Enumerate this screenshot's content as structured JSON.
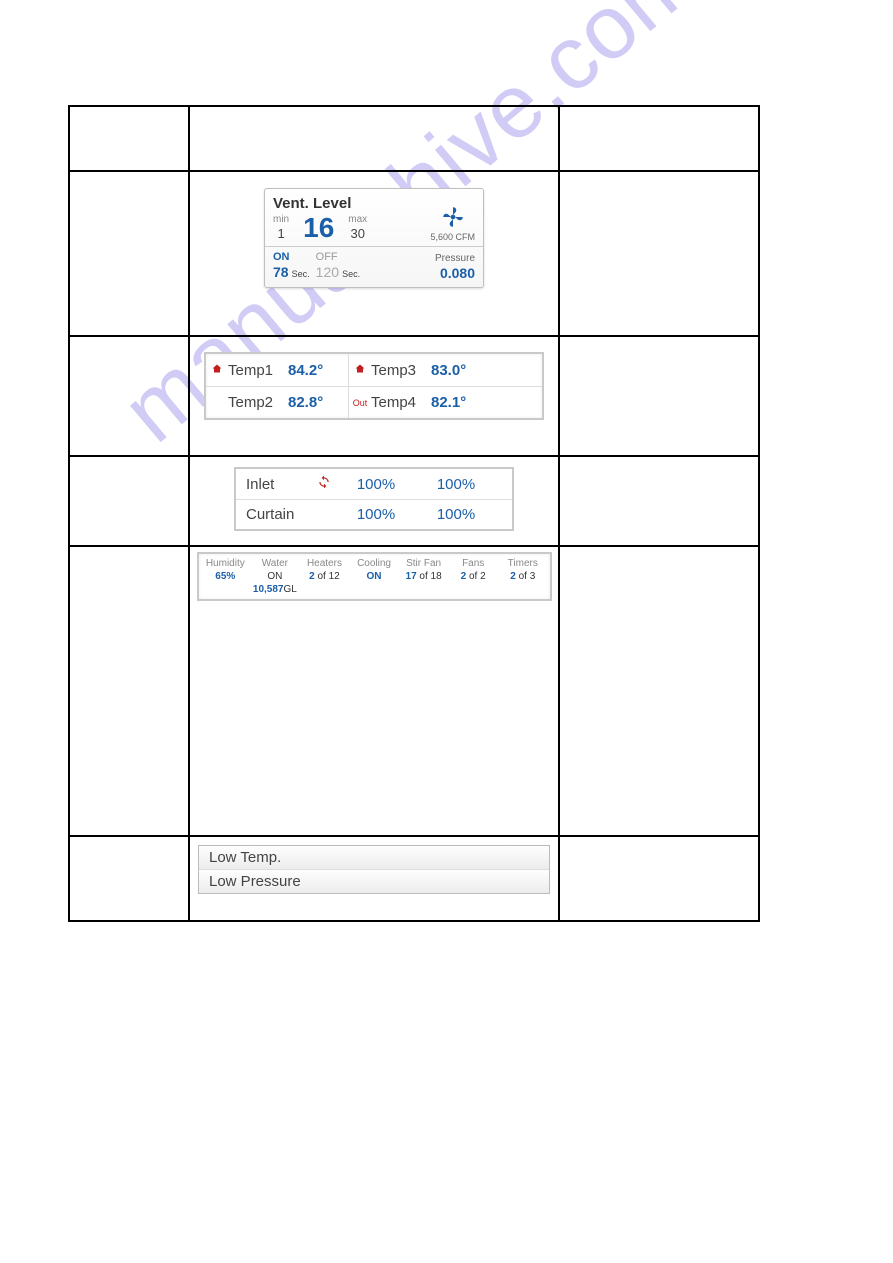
{
  "watermark": "manualshive.com",
  "vent": {
    "title": "Vent. Level",
    "min_label": "min",
    "min_value": "1",
    "level": "16",
    "max_label": "max",
    "max_value": "30",
    "cfm": "5,600 CFM",
    "on_label": "ON",
    "on_value": "78",
    "on_unit": "Sec.",
    "off_label": "OFF",
    "off_value": "120",
    "off_unit": "Sec.",
    "pressure_label": "Pressure",
    "pressure_value": "0.080"
  },
  "temps": {
    "t1_label": "Temp1",
    "t1_value": "84.2°",
    "t2_label": "Temp2",
    "t2_value": "82.8°",
    "t3_label": "Temp3",
    "t3_value": "83.0°",
    "t4_label": "Temp4",
    "t4_value": "82.1°",
    "out_tag": "Out"
  },
  "inlet": {
    "row1_label": "Inlet",
    "row1_v1": "100%",
    "row1_v2": "100%",
    "row2_label": "Curtain",
    "row2_v1": "100%",
    "row2_v2": "100%"
  },
  "status": {
    "humidity_hdr": "Humidity",
    "humidity_val_b": "65%",
    "water_hdr": "Water",
    "water_on": "ON",
    "water_val_b": "10,587",
    "water_unit": "GL",
    "heaters_hdr": "Heaters",
    "heaters_b": "2",
    "heaters_rest": " of 12",
    "cooling_hdr": "Cooling",
    "cooling_b": "ON",
    "stirfan_hdr": "Stir Fan",
    "stirfan_b": "17",
    "stirfan_rest": " of 18",
    "fans_hdr": "Fans",
    "fans_b": "2",
    "fans_rest": " of 2",
    "timers_hdr": "Timers",
    "timers_b": "2",
    "timers_rest": " of 3"
  },
  "alarms": {
    "row1": "Low Temp.",
    "row2": "Low Pressure"
  }
}
